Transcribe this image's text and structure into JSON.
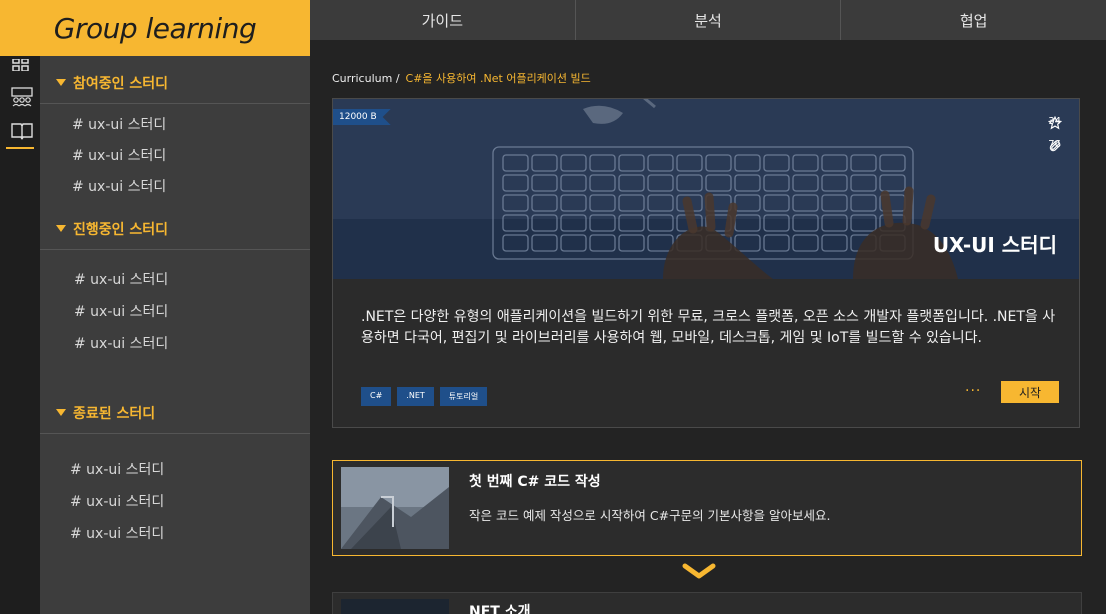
{
  "app": {
    "logo_text": "Group learning"
  },
  "nav": {
    "tabs": [
      "가이드",
      "분석",
      "협업"
    ]
  },
  "rail": {
    "icons": [
      "grid-icon",
      "people-icon",
      "book-icon"
    ]
  },
  "sidebar": {
    "sections": [
      {
        "title": "참여중인 스터디",
        "items": [
          "# ux-ui 스터디",
          "# ux-ui 스터디",
          "# ux-ui 스터디"
        ]
      },
      {
        "title": "진행중인 스터디",
        "items": [
          "# ux-ui 스터디",
          "# ux-ui 스터디",
          "# ux-ui 스터디"
        ]
      },
      {
        "title": "종료된 스터디",
        "items": [
          "# ux-ui 스터디",
          "# ux-ui 스터디",
          "# ux-ui 스터디"
        ]
      }
    ]
  },
  "breadcrumb": {
    "root": "Curriculum /",
    "current": "C#을 사용하여 .Net 어플리케이션 빌드"
  },
  "course": {
    "badge": "12000 B",
    "stars": "34",
    "attachments": "76",
    "title": "UX-UI 스터디",
    "description": ".NET은 다양한 유형의 애플리케이션을 빌드하기 위한 무료, 크로스 플랫폼, 오픈 소스 개발자 플랫폼입니다. .NET을 사용하면 다국어, 편집기 및 라이브러리를 사용하여 웹, 모바일, 데스크톱, 게임 및 IoT를 빌드할 수 있습니다.",
    "tags": [
      "C#",
      ".NET",
      "튜토리얼"
    ],
    "more": "···",
    "start_label": "시작"
  },
  "lessons": [
    {
      "title": "첫 번째 C# 코드 작성",
      "desc": "작은 코드 예제 작성으로 시작하여 C#구문의 기본사항을 알아보세요."
    },
    {
      "title": "NET 소개"
    }
  ],
  "colors": {
    "accent": "#f7b731",
    "tag_blue": "#1f4f8a"
  }
}
